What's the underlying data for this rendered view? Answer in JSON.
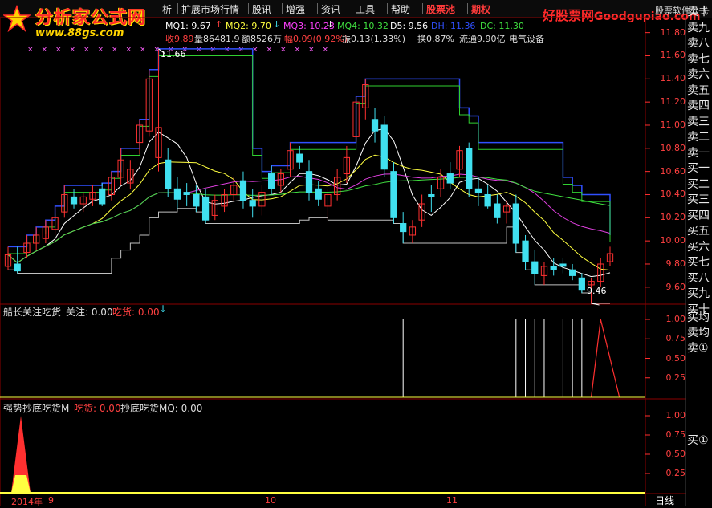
{
  "app": {
    "logo_title": "分析家公式网",
    "logo_url": "www.88gs.com",
    "brand": "好股票网",
    "brand_domain": "Goodgupiao.com",
    "brand_sub": "股票软件公式"
  },
  "menu": {
    "items": [
      {
        "label": "析",
        "x": 202
      },
      {
        "label": "扩展市场行情",
        "x": 226
      },
      {
        "label": "股讯",
        "x": 314
      },
      {
        "label": "增强",
        "x": 356
      },
      {
        "label": "资讯",
        "x": 400
      },
      {
        "label": "工具",
        "x": 443
      },
      {
        "label": "帮助",
        "x": 487
      },
      {
        "label": "股票池",
        "x": 531,
        "highlight": true
      },
      {
        "label": "期权",
        "x": 587,
        "highlight": true
      }
    ]
  },
  "main_info": {
    "mq1": "MQ1: 9.67",
    "mq2": "MQ2: 9.70",
    "mq3": "MQ3: 10.23",
    "mq4": "MQ4: 10.32",
    "d5": "D5: 9.56",
    "dh": "DH: 11.36",
    "dc": "DC: 11.30",
    "line2_a": "收9.89",
    "line2_b": "量86481.9",
    "line2_c": "额8526万",
    "line2_d": "幅0.09(0.92%)",
    "line2_e": "振0.13(1.33%)",
    "line2_f": "换0.87%",
    "line2_g": "流通9.90亿",
    "line2_h": "电气设备"
  },
  "main_axis": [
    "11.80",
    "11.60",
    "11.40",
    "11.20",
    "11.00",
    "10.80",
    "10.60",
    "10.40",
    "10.20",
    "10.00",
    "9.80",
    "9.60"
  ],
  "annotations": {
    "high": "11.66",
    "low": "9.46"
  },
  "panel2": {
    "title": "船长关注吃货",
    "label1": "关注: 0.00",
    "label2": "吃货: 0.00",
    "axis": [
      "1.00",
      "0.75",
      "0.50",
      "0.25"
    ]
  },
  "panel3": {
    "title": "强势抄底吃货M",
    "label1": "吃货: 0.00",
    "label2": "抄底吃货MQ: 0.00",
    "axis": [
      "1.00",
      "0.75",
      "0.50",
      "0.25"
    ]
  },
  "bottom": {
    "year": "2014年",
    "months": [
      "9",
      "10",
      "11"
    ],
    "period": "日线"
  },
  "side_buttons": {
    "sell": [
      "卖十",
      "卖九",
      "卖八",
      "卖七",
      "卖六",
      "卖五",
      "卖四",
      "卖三",
      "卖二",
      "卖一"
    ],
    "buy": [
      "买一",
      "买二",
      "买三",
      "买四",
      "买五",
      "买六",
      "买七",
      "买八",
      "买九",
      "买十"
    ],
    "extra": [
      "买均",
      "卖均",
      "卖①"
    ],
    "extra_bottom": "买①"
  },
  "colors": {
    "up": "#ff3030",
    "down": "#40e0f0",
    "ma_white": "#ffffff",
    "ma_yellow": "#ffff40",
    "ma_magenta": "#e040e0",
    "ma_green": "#40e040",
    "channel_blue": "#3050ff",
    "channel_green": "#30d030",
    "axis_red": "#ff3030",
    "grid": "#8b0000"
  },
  "chart_data": {
    "type": "candlestick",
    "ylim": [
      9.46,
      11.86
    ],
    "candles": [
      {
        "o": 9.78,
        "h": 9.95,
        "l": 9.75,
        "c": 9.88
      },
      {
        "o": 9.8,
        "h": 9.95,
        "l": 9.72,
        "c": 9.74
      },
      {
        "o": 9.9,
        "h": 10.05,
        "l": 9.85,
        "c": 9.98
      },
      {
        "o": 9.98,
        "h": 10.12,
        "l": 9.92,
        "c": 10.05
      },
      {
        "o": 10.02,
        "h": 10.18,
        "l": 9.98,
        "c": 10.12
      },
      {
        "o": 10.1,
        "h": 10.3,
        "l": 10.05,
        "c": 10.2
      },
      {
        "o": 10.25,
        "h": 10.48,
        "l": 10.2,
        "c": 10.4
      },
      {
        "o": 10.38,
        "h": 10.45,
        "l": 10.28,
        "c": 10.32
      },
      {
        "o": 10.32,
        "h": 10.42,
        "l": 10.25,
        "c": 10.38
      },
      {
        "o": 10.36,
        "h": 10.48,
        "l": 10.3,
        "c": 10.42
      },
      {
        "o": 10.45,
        "h": 10.5,
        "l": 10.3,
        "c": 10.32
      },
      {
        "o": 10.4,
        "h": 10.6,
        "l": 10.35,
        "c": 10.55
      },
      {
        "o": 10.55,
        "h": 10.8,
        "l": 10.48,
        "c": 10.7
      },
      {
        "o": 10.5,
        "h": 10.7,
        "l": 10.45,
        "c": 10.62
      },
      {
        "o": 10.85,
        "h": 11.05,
        "l": 10.75,
        "c": 11.0
      },
      {
        "o": 10.95,
        "h": 11.48,
        "l": 10.9,
        "c": 11.4
      },
      {
        "o": 10.72,
        "h": 11.66,
        "l": 10.6,
        "c": 10.98
      },
      {
        "o": 10.7,
        "h": 10.8,
        "l": 10.38,
        "c": 10.45
      },
      {
        "o": 10.45,
        "h": 10.55,
        "l": 10.28,
        "c": 10.36
      },
      {
        "o": 10.42,
        "h": 10.5,
        "l": 10.3,
        "c": 10.4
      },
      {
        "o": 10.4,
        "h": 10.48,
        "l": 10.25,
        "c": 10.3
      },
      {
        "o": 10.38,
        "h": 10.45,
        "l": 10.15,
        "c": 10.18
      },
      {
        "o": 10.22,
        "h": 10.4,
        "l": 10.18,
        "c": 10.35
      },
      {
        "o": 10.3,
        "h": 10.45,
        "l": 10.25,
        "c": 10.4
      },
      {
        "o": 10.4,
        "h": 10.55,
        "l": 10.35,
        "c": 10.48
      },
      {
        "o": 10.52,
        "h": 10.6,
        "l": 10.28,
        "c": 10.35
      },
      {
        "o": 10.35,
        "h": 10.45,
        "l": 10.2,
        "c": 10.3
      },
      {
        "o": 10.3,
        "h": 10.48,
        "l": 10.22,
        "c": 10.42
      },
      {
        "o": 10.58,
        "h": 10.65,
        "l": 10.4,
        "c": 10.45
      },
      {
        "o": 10.48,
        "h": 10.62,
        "l": 10.42,
        "c": 10.58
      },
      {
        "o": 10.62,
        "h": 10.85,
        "l": 10.55,
        "c": 10.78
      },
      {
        "o": 10.75,
        "h": 10.82,
        "l": 10.62,
        "c": 10.68
      },
      {
        "o": 10.6,
        "h": 10.7,
        "l": 10.35,
        "c": 10.42
      },
      {
        "o": 10.45,
        "h": 10.52,
        "l": 10.3,
        "c": 10.36
      },
      {
        "o": 10.3,
        "h": 10.45,
        "l": 10.18,
        "c": 10.4
      },
      {
        "o": 10.4,
        "h": 10.62,
        "l": 10.35,
        "c": 10.55
      },
      {
        "o": 10.58,
        "h": 10.82,
        "l": 10.5,
        "c": 10.72
      },
      {
        "o": 10.9,
        "h": 11.25,
        "l": 10.85,
        "c": 11.2
      },
      {
        "o": 11.15,
        "h": 11.4,
        "l": 11.05,
        "c": 11.35
      },
      {
        "o": 11.05,
        "h": 11.15,
        "l": 10.85,
        "c": 10.95
      },
      {
        "o": 11.0,
        "h": 11.08,
        "l": 10.55,
        "c": 10.62
      },
      {
        "o": 10.6,
        "h": 10.68,
        "l": 10.15,
        "c": 10.2
      },
      {
        "o": 10.15,
        "h": 10.25,
        "l": 9.98,
        "c": 10.08
      },
      {
        "o": 10.05,
        "h": 10.18,
        "l": 9.98,
        "c": 10.12
      },
      {
        "o": 10.18,
        "h": 10.4,
        "l": 10.12,
        "c": 10.32
      },
      {
        "o": 10.4,
        "h": 10.48,
        "l": 10.25,
        "c": 10.38
      },
      {
        "o": 10.45,
        "h": 10.62,
        "l": 10.38,
        "c": 10.55
      },
      {
        "o": 10.58,
        "h": 10.68,
        "l": 10.45,
        "c": 10.5
      },
      {
        "o": 10.62,
        "h": 10.82,
        "l": 10.55,
        "c": 10.78
      },
      {
        "o": 10.8,
        "h": 10.85,
        "l": 10.38,
        "c": 10.45
      },
      {
        "o": 10.45,
        "h": 10.55,
        "l": 10.3,
        "c": 10.42
      },
      {
        "o": 10.4,
        "h": 10.48,
        "l": 10.28,
        "c": 10.3
      },
      {
        "o": 10.32,
        "h": 10.4,
        "l": 10.15,
        "c": 10.2
      },
      {
        "o": 10.25,
        "h": 10.35,
        "l": 10.15,
        "c": 10.3
      },
      {
        "o": 10.32,
        "h": 10.4,
        "l": 9.9,
        "c": 9.98
      },
      {
        "o": 10.0,
        "h": 10.05,
        "l": 9.75,
        "c": 9.82
      },
      {
        "o": 9.82,
        "h": 9.92,
        "l": 9.62,
        "c": 9.72
      },
      {
        "o": 9.7,
        "h": 9.82,
        "l": 9.62,
        "c": 9.78
      },
      {
        "o": 9.78,
        "h": 9.85,
        "l": 9.7,
        "c": 9.75
      },
      {
        "o": 9.8,
        "h": 9.85,
        "l": 9.72,
        "c": 9.78
      },
      {
        "o": 9.75,
        "h": 9.8,
        "l": 9.66,
        "c": 9.7
      },
      {
        "o": 9.68,
        "h": 9.72,
        "l": 9.55,
        "c": 9.58
      },
      {
        "o": 9.62,
        "h": 9.68,
        "l": 9.46,
        "c": 9.65
      },
      {
        "o": 9.65,
        "h": 9.85,
        "l": 9.6,
        "c": 9.8
      },
      {
        "o": 9.82,
        "h": 9.95,
        "l": 9.78,
        "c": 9.89
      }
    ],
    "panel2_spikes": [
      42,
      54,
      55,
      56,
      57,
      59,
      60,
      61
    ],
    "panel2_triangle": {
      "start": 62,
      "peak": 63,
      "end": 65,
      "value": 1.0
    },
    "panel3_pulse": {
      "index": 0,
      "value": 1.0
    }
  }
}
